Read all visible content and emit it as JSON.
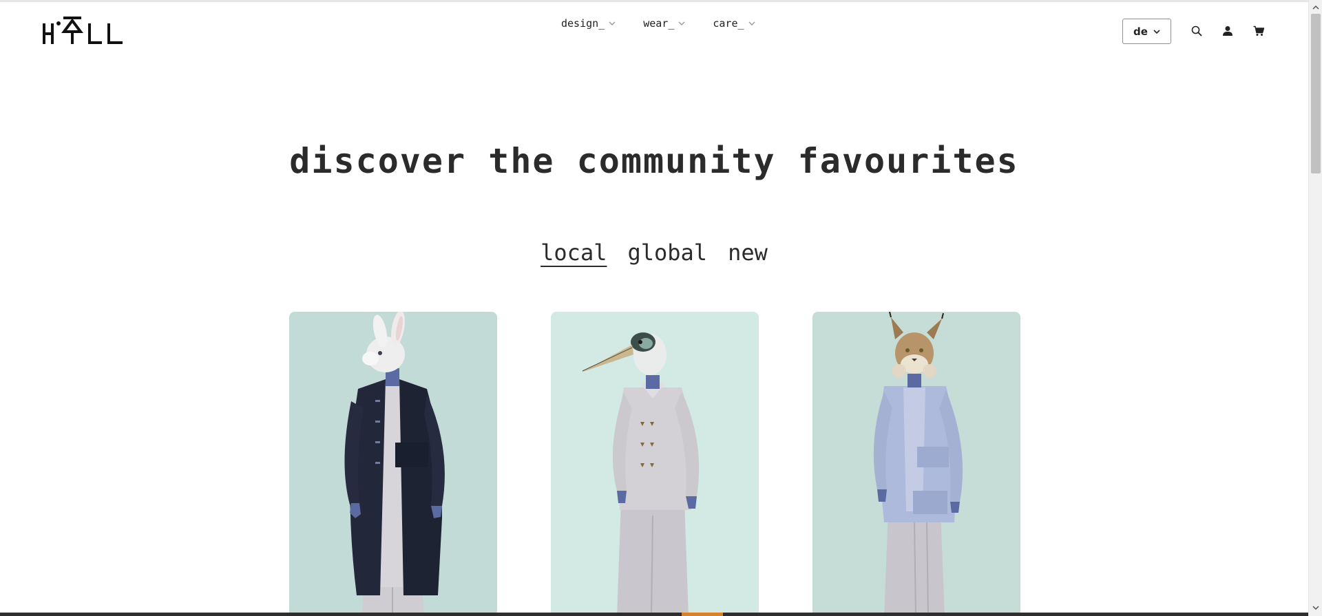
{
  "header": {
    "logo_text": "H•ALL",
    "nav": [
      {
        "label": "design_"
      },
      {
        "label": "wear_"
      },
      {
        "label": "care_"
      }
    ],
    "language": {
      "selected": "de"
    },
    "icons": [
      "search-icon",
      "user-icon",
      "cart-icon"
    ]
  },
  "hero": {
    "title": "discover the community favourites"
  },
  "tabs": [
    {
      "label": "local",
      "active": true
    },
    {
      "label": "global",
      "active": false
    },
    {
      "label": "new",
      "active": false
    }
  ],
  "products": [
    {
      "figure": "rabbit head, navy long coat over white",
      "background": "#c3dbd6"
    },
    {
      "figure": "stork head, white double-breasted jacket",
      "background": "#d3e9e4"
    },
    {
      "figure": "lynx head, light blue layered cardigan",
      "background": "#c6dcd7"
    }
  ],
  "colors": {
    "text": "#2b2b2b",
    "card_mint": "#c3dbd6",
    "card_light_mint": "#d3e9e4",
    "accent_orange": "#d9822b"
  }
}
